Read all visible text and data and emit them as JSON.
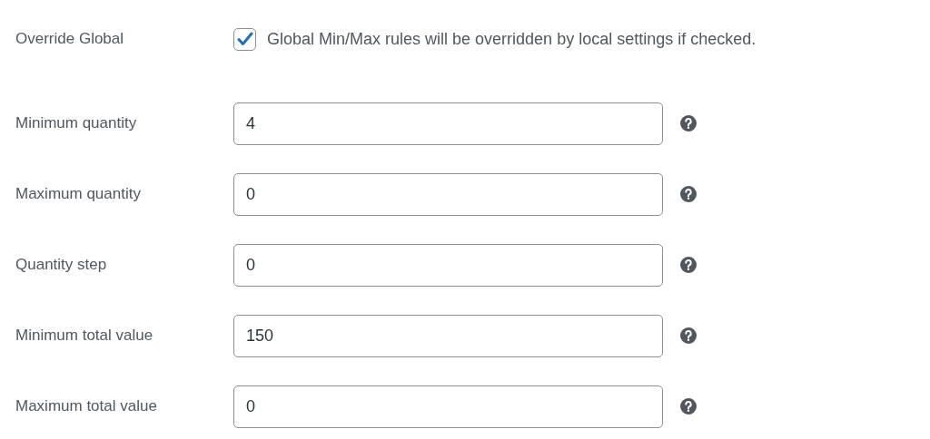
{
  "override": {
    "label": "Override Global",
    "checked": true,
    "description": "Global Min/Max rules will be overridden by local settings if checked."
  },
  "fields": [
    {
      "label": "Minimum quantity",
      "value": "4"
    },
    {
      "label": "Maximum quantity",
      "value": "0"
    },
    {
      "label": "Quantity step",
      "value": "0"
    },
    {
      "label": "Minimum total value",
      "value": "150"
    },
    {
      "label": "Maximum total value",
      "value": "0"
    }
  ]
}
